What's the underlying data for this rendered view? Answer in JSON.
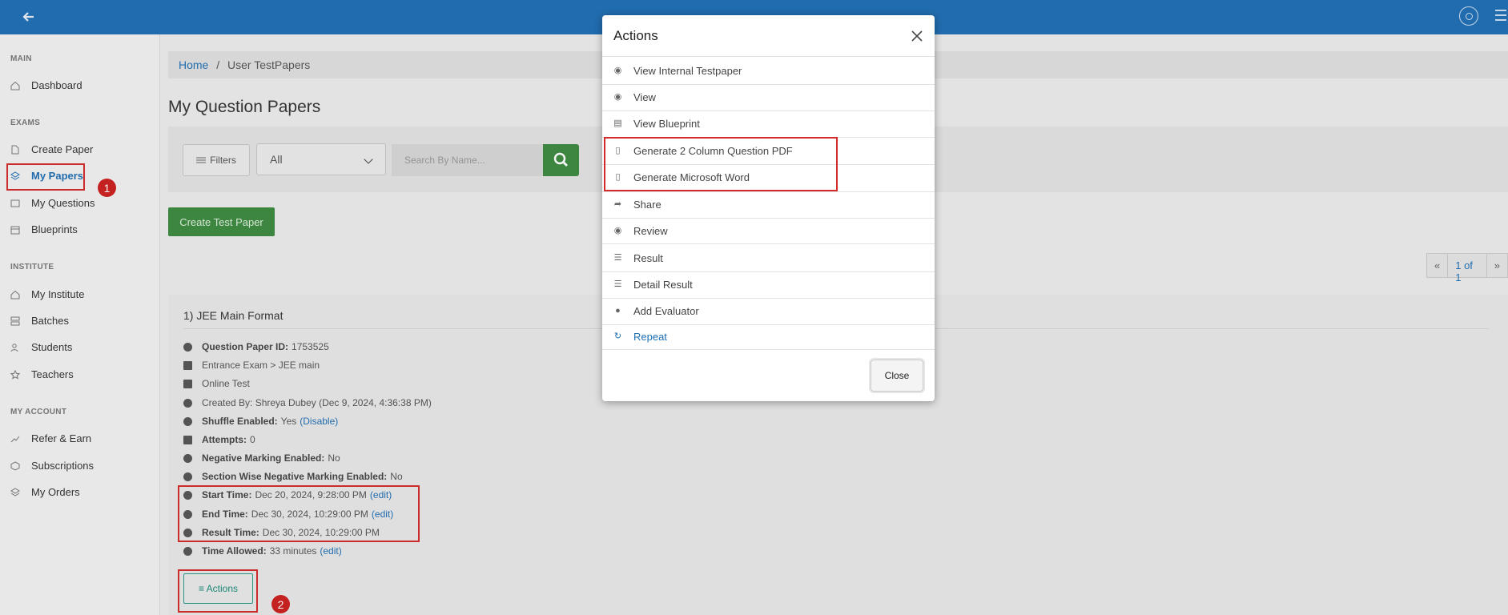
{
  "sidebar": {
    "sections": {
      "main": "MAIN",
      "exams": "EXAMS",
      "institute": "INSTITUTE",
      "account": "MY ACCOUNT"
    },
    "items": [
      {
        "label": "Dashboard",
        "icon": "home-icon"
      },
      {
        "label": "Create Paper",
        "icon": "file-plus-icon"
      },
      {
        "label": "My Papers",
        "icon": "layers-icon",
        "active": true
      },
      {
        "label": "My Questions",
        "icon": "archive-icon"
      },
      {
        "label": "Blueprints",
        "icon": "calendar-icon"
      },
      {
        "label": "My Institute",
        "icon": "home-icon"
      },
      {
        "label": "Batches",
        "icon": "server-icon"
      },
      {
        "label": "Students",
        "icon": "users-icon"
      },
      {
        "label": "Teachers",
        "icon": "star-icon"
      },
      {
        "label": "Refer & Earn",
        "icon": "trending-up-icon"
      },
      {
        "label": "Subscriptions",
        "icon": "package-icon"
      },
      {
        "label": "My Orders",
        "icon": "layers-icon"
      }
    ]
  },
  "annotations": {
    "badge1": "1",
    "badge2": "2"
  },
  "breadcrumb": {
    "home": "Home",
    "sep": "/",
    "current": "User TestPapers"
  },
  "page_title": "My Question Papers",
  "filters": {
    "filters_label": "Filters",
    "select_value": "All",
    "search_placeholder": "Search By Name..."
  },
  "create_button": "Create Test Paper",
  "pager": {
    "prev": "«",
    "current": "1 of 1",
    "next": "»"
  },
  "paper": {
    "title": "1) JEE Main Format",
    "id_label": "Question Paper ID:",
    "id_value": "1753525",
    "category": "Entrance Exam > JEE main",
    "mode": "Online Test",
    "created": "Created By: Shreya Dubey (Dec 9, 2024, 4:36:38 PM)",
    "shuffle_label": "Shuffle Enabled:",
    "shuffle_value": "Yes",
    "shuffle_link": "(Disable)",
    "attempts_label": "Attempts:",
    "attempts_value": "0",
    "neg_label": "Negative Marking Enabled:",
    "neg_value": "No",
    "secneg_label": "Section Wise Negative Marking Enabled:",
    "secneg_value": "No",
    "start_label": "Start Time:",
    "start_value": "Dec 20, 2024, 9:28:00 PM",
    "end_label": "End Time:",
    "end_value": "Dec 30, 2024, 10:29:00 PM",
    "result_label": "Result Time:",
    "result_value": "Dec 30, 2024, 10:29:00 PM",
    "time_label": "Time Allowed:",
    "time_value": "33 minutes",
    "edit": "(edit)",
    "actions_button": "≡ Actions"
  },
  "modal": {
    "title": "Actions",
    "items": [
      {
        "label": "View Internal Testpaper",
        "icon": "eye-icon"
      },
      {
        "label": "View",
        "icon": "eye-icon"
      },
      {
        "label": "View Blueprint",
        "icon": "file-icon"
      },
      {
        "label": "Generate 2 Column Question PDF",
        "icon": "pdf-icon"
      },
      {
        "label": "Generate Microsoft Word",
        "icon": "pdf-icon"
      },
      {
        "label": "Share",
        "icon": "share-icon"
      },
      {
        "label": "Review",
        "icon": "eye-icon"
      },
      {
        "label": "Result",
        "icon": "list-icon"
      },
      {
        "label": "Detail Result",
        "icon": "list-icon"
      },
      {
        "label": "Add Evaluator",
        "icon": "user-icon"
      },
      {
        "label": "Repeat",
        "icon": "refresh-icon"
      }
    ],
    "close_label": "Close"
  },
  "colors": {
    "topbar": "#1f6fb5",
    "accent_green": "#3d8b40",
    "annotation_red": "#d42a2a",
    "link_blue": "#1f6fb5"
  }
}
